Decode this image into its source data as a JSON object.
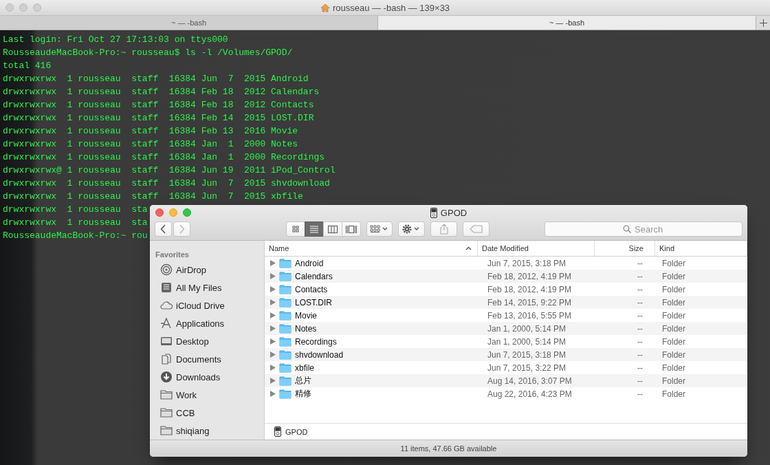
{
  "terminal": {
    "title": "rousseau — -bash — 139×33",
    "tabs": [
      {
        "label": "~ — -bash",
        "selected": false
      },
      {
        "label": "~ — -bash",
        "selected": true
      }
    ],
    "lines": [
      "Last login: Fri Oct 27 17:13:03 on ttys000",
      "RousseaudeMacBook-Pro:~ rousseau$ ls -l /Volumes/GPOD/",
      "total 416",
      "drwxrwxrwx  1 rousseau  staff  16384 Jun  7  2015 Android",
      "drwxrwxrwx  1 rousseau  staff  16384 Feb 18  2012 Calendars",
      "drwxrwxrwx  1 rousseau  staff  16384 Feb 18  2012 Contacts",
      "drwxrwxrwx  1 rousseau  staff  16384 Feb 14  2015 LOST.DIR",
      "drwxrwxrwx  1 rousseau  staff  16384 Feb 13  2016 Movie",
      "drwxrwxrwx  1 rousseau  staff  16384 Jan  1  2000 Notes",
      "drwxrwxrwx  1 rousseau  staff  16384 Jan  1  2000 Recordings",
      "drwxrwxrwx@ 1 rousseau  staff  16384 Jun 19  2011 iPod_Control",
      "drwxrwxrwx  1 rousseau  staff  16384 Jun  7  2015 shvdownload",
      "drwxrwxrwx  1 rousseau  staff  16384 Jun  7  2015 xbfile",
      "drwxrwxrwx  1 rousseau  sta",
      "drwxrwxrwx  1 rousseau  sta",
      "RousseaudeMacBook-Pro:~ rou"
    ]
  },
  "finder": {
    "title": "GPOD",
    "view_modes": [
      {
        "kind": "icon",
        "selected": false
      },
      {
        "kind": "list",
        "selected": true
      },
      {
        "kind": "column",
        "selected": false
      },
      {
        "kind": "cover",
        "selected": false
      }
    ],
    "search": {
      "placeholder": "Search"
    },
    "sidebar": {
      "heading": "Favorites",
      "items": [
        {
          "label": "AirDrop",
          "kind": "airdrop"
        },
        {
          "label": "All My Files",
          "kind": "files"
        },
        {
          "label": "iCloud Drive",
          "kind": "cloud"
        },
        {
          "label": "Applications",
          "kind": "apps"
        },
        {
          "label": "Desktop",
          "kind": "desktop"
        },
        {
          "label": "Documents",
          "kind": "documents"
        },
        {
          "label": "Downloads",
          "kind": "downloads"
        },
        {
          "label": "Work",
          "kind": "folder"
        },
        {
          "label": "CCB",
          "kind": "folder"
        },
        {
          "label": "shiqiang",
          "kind": "folder"
        }
      ]
    },
    "columns": [
      {
        "label": "Name",
        "sorted": true
      },
      {
        "label": "Date Modified",
        "sorted": false
      },
      {
        "label": "Size",
        "sorted": false
      },
      {
        "label": "Kind",
        "sorted": false
      }
    ],
    "rows": [
      {
        "name": "Android",
        "date": "Jun 7, 2015, 3:18 PM",
        "size": "--",
        "kind": "Folder"
      },
      {
        "name": "Calendars",
        "date": "Feb 18, 2012, 4:19 PM",
        "size": "--",
        "kind": "Folder"
      },
      {
        "name": "Contacts",
        "date": "Feb 18, 2012, 4:19 PM",
        "size": "--",
        "kind": "Folder"
      },
      {
        "name": "LOST.DIR",
        "date": "Feb 14, 2015, 9:22 PM",
        "size": "--",
        "kind": "Folder"
      },
      {
        "name": "Movie",
        "date": "Feb 13, 2016, 5:55 PM",
        "size": "--",
        "kind": "Folder"
      },
      {
        "name": "Notes",
        "date": "Jan 1, 2000, 5:14 PM",
        "size": "--",
        "kind": "Folder"
      },
      {
        "name": "Recordings",
        "date": "Jan 1, 2000, 5:14 PM",
        "size": "--",
        "kind": "Folder"
      },
      {
        "name": "shvdownload",
        "date": "Jun 7, 2015, 3:18 PM",
        "size": "--",
        "kind": "Folder"
      },
      {
        "name": "xbfile",
        "date": "Jun 7, 2015, 3:22 PM",
        "size": "--",
        "kind": "Folder"
      },
      {
        "name": "总片",
        "date": "Aug 14, 2016, 3:07 PM",
        "size": "--",
        "kind": "Folder"
      },
      {
        "name": "精修",
        "date": "Aug 22, 2016, 4:23 PM",
        "size": "--",
        "kind": "Folder"
      }
    ],
    "path_bar": "GPOD",
    "status_bar": "11 items, 47.66 GB available"
  }
}
